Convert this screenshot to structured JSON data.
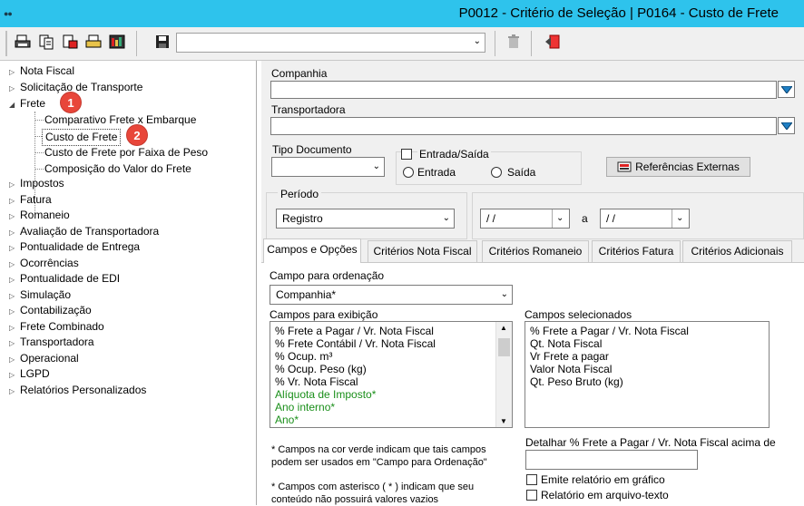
{
  "window": {
    "title": "P0012 - Critério de Seleção | P0164 - Custo de Frete"
  },
  "toolbar": {
    "combo_value": "",
    "icons": [
      "print-icon",
      "copy-icon",
      "export-icon",
      "printer-icon",
      "report-icon",
      "save-icon",
      "trash-icon",
      "exit-icon"
    ]
  },
  "tree": {
    "items": [
      {
        "label": "Nota Fiscal",
        "expanded": false
      },
      {
        "label": "Solicitação de Transporte",
        "expanded": false
      },
      {
        "label": "Frete",
        "expanded": true
      },
      {
        "label": "Impostos",
        "expanded": false
      },
      {
        "label": "Fatura",
        "expanded": false
      },
      {
        "label": "Romaneio",
        "expanded": false
      },
      {
        "label": "Avaliação de Transportadora",
        "expanded": false
      },
      {
        "label": "Pontualidade de Entrega",
        "expanded": false
      },
      {
        "label": "Ocorrências",
        "expanded": false
      },
      {
        "label": "Pontualidade de EDI",
        "expanded": false
      },
      {
        "label": "Simulação",
        "expanded": false
      },
      {
        "label": "Contabilização",
        "expanded": false
      },
      {
        "label": "Frete Combinado",
        "expanded": false
      },
      {
        "label": "Transportadora",
        "expanded": false
      },
      {
        "label": "Operacional",
        "expanded": false
      },
      {
        "label": "LGPD",
        "expanded": false
      },
      {
        "label": "Relatórios Personalizados",
        "expanded": false
      }
    ],
    "frete_children": [
      {
        "label": "Comparativo Frete x Embarque"
      },
      {
        "label": "Custo de Frete",
        "selected": true
      },
      {
        "label": "Custo de Frete por Faixa de Peso"
      },
      {
        "label": "Composição do Valor do Frete"
      }
    ],
    "badges": [
      "1",
      "2"
    ]
  },
  "form": {
    "companhia_label": "Companhia",
    "companhia_value": "",
    "transportadora_label": "Transportadora",
    "transportadora_value": "",
    "tipo_documento_label": "Tipo Documento",
    "tipo_documento_value": "",
    "entrada_saida_label": "Entrada/Saída",
    "entrada_label": "Entrada",
    "saida_label": "Saída",
    "referencias_button": "Referências Externas",
    "periodo_label": "Período",
    "periodo_value": "Registro",
    "date_from": " / /",
    "date_sep": "a",
    "date_to": " / /"
  },
  "tabs": [
    {
      "label": "Campos e Opções",
      "active": true
    },
    {
      "label": "Critérios Nota Fiscal"
    },
    {
      "label": "Critérios Romaneio"
    },
    {
      "label": "Critérios Fatura"
    },
    {
      "label": "Critérios Adicionais"
    }
  ],
  "options": {
    "ordenacao_label": "Campo para ordenação",
    "ordenacao_value": "Companhia*",
    "exibicao_label": "Campos para exibição",
    "exibicao_items": [
      {
        "text": "% Frete a Pagar / Vr. Nota Fiscal",
        "green": false
      },
      {
        "text": "% Frete Contábil / Vr. Nota Fiscal",
        "green": false
      },
      {
        "text": "% Ocup. m³",
        "green": false
      },
      {
        "text": "% Ocup. Peso (kg)",
        "green": false
      },
      {
        "text": "% Vr. Nota Fiscal",
        "green": false
      },
      {
        "text": "Alíquota de Imposto*",
        "green": true
      },
      {
        "text": "Ano interno*",
        "green": true
      },
      {
        "text": "Ano*",
        "green": true
      }
    ],
    "selecionados_label": "Campos selecionados",
    "selecionados_items": [
      "% Frete a Pagar / Vr. Nota Fiscal",
      "Qt. Nota Fiscal",
      "Vr Frete a pagar",
      "Valor Nota Fiscal",
      "Qt. Peso Bruto (kg)"
    ],
    "note1_line1": "* Campos na cor verde indicam que tais campos",
    "note1_line2": "podem ser usados em \"Campo para Ordenação\"",
    "note2_line1": "* Campos com asterisco ( * ) indicam que seu",
    "note2_line2": "conteúdo não possuirá valores vazios",
    "detalhar_label": "Detalhar % Frete a Pagar / Vr. Nota Fiscal acima de",
    "detalhar_value": "",
    "grafico_label": "Emite relatório em gráfico",
    "texto_label": "Relatório em arquivo-texto"
  },
  "colors": {
    "titlebar": "#2ec3ec",
    "badge": "#e8463a",
    "green_text": "#1a8f1a"
  }
}
